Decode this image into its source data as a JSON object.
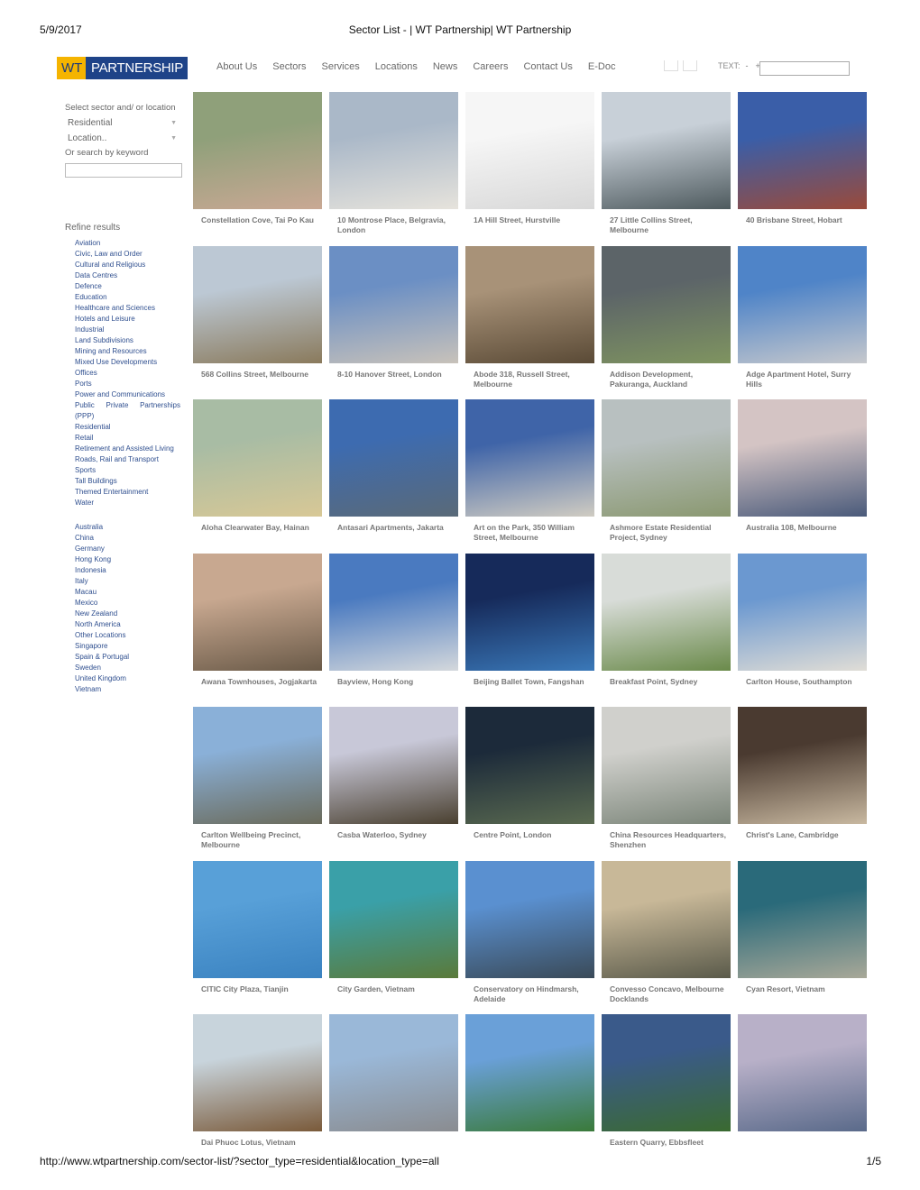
{
  "print": {
    "date": "5/9/2017",
    "title": "Sector List - | WT Partnership| WT Partnership",
    "url": "http://www.wtpartnership.com/sector-list/?sector_type=residential&location_type=all",
    "page": "1/5"
  },
  "logo": {
    "wt": "WT",
    "partnership": "PARTNERSHIP",
    "wt_bg": "#f5b400",
    "partnership_bg": "#1e4388"
  },
  "nav": [
    "About Us",
    "Sectors",
    "Services",
    "Locations",
    "News",
    "Careers",
    "Contact Us",
    "E-Doc"
  ],
  "tools": {
    "text_label": "TEXT:",
    "decrease": "-",
    "increase": "+",
    "search_placeholder": ""
  },
  "sidebar": {
    "select_label": "Select sector and/ or location",
    "sector_value": "Residential",
    "location_value": "Location..",
    "keyword_label": "Or search by keyword",
    "keyword_value": "",
    "refine_label": "Refine results",
    "sectors": [
      "Aviation",
      "Civic, Law and Order",
      "Cultural and Religious",
      "Data Centres",
      "Defence",
      "Education",
      "Healthcare and Sciences",
      "Hotels and Leisure",
      "Industrial",
      "Land Subdivisions",
      "Mining and Resources",
      "Mixed Use Developments",
      "Offices",
      "Ports",
      "Power and Communications",
      "Public Private Partnerships (PPP)",
      "Residential",
      "Retail",
      "Retirement and Assisted Living",
      "Roads, Rail and Transport",
      "Sports",
      "Tall Buildings",
      "Themed Entertainment",
      "Water"
    ],
    "locations": [
      "Australia",
      "China",
      "Germany",
      "Hong Kong",
      "Indonesia",
      "Italy",
      "Macau",
      "Mexico",
      "New Zealand",
      "North America",
      "Other Locations",
      "Singapore",
      "Spain & Portugal",
      "Sweden",
      "United Kingdom",
      "Vietnam"
    ]
  },
  "projects": [
    {
      "title": "Constellation Cove, Tai Po Kau",
      "c1": "#8fa07a",
      "c2": "#c9a894"
    },
    {
      "title": "10 Montrose Place, Belgravia, London",
      "c1": "#aab8c8",
      "c2": "#e6e3dc"
    },
    {
      "title": "1A Hill Street, Hurstville",
      "c1": "#f6f6f6",
      "c2": "#d8d8d8"
    },
    {
      "title": "27 Little Collins Street, Melbourne",
      "c1": "#c8d0d8",
      "c2": "#4e5a5e"
    },
    {
      "title": "40 Brisbane Street, Hobart",
      "c1": "#3a5ea8",
      "c2": "#9a4a3a"
    },
    {
      "title": "568 Collins Street, Melbourne",
      "c1": "#bcc8d4",
      "c2": "#8a7a5c"
    },
    {
      "title": "8-10 Hanover Street, London",
      "c1": "#6b8fc4",
      "c2": "#c8c2ba"
    },
    {
      "title": "Abode 318, Russell Street, Melbourne",
      "c1": "#a89278",
      "c2": "#5a4a36"
    },
    {
      "title": "Addison Development, Pakuranga, Auckland",
      "c1": "#5c6468",
      "c2": "#7f9460"
    },
    {
      "title": "Adge Apartment Hotel, Surry Hills",
      "c1": "#4f84c8",
      "c2": "#c6c8cc"
    },
    {
      "title": "Aloha Clearwater Bay, Hainan",
      "c1": "#a8bca4",
      "c2": "#d8c896"
    },
    {
      "title": "Antasari Apartments, Jakarta",
      "c1": "#3d6bb0",
      "c2": "#5a6a78"
    },
    {
      "title": "Art on the Park, 350 William Street, Melbourne",
      "c1": "#3f64a8",
      "c2": "#d0ccc2"
    },
    {
      "title": "Ashmore Estate Residential Project, Sydney",
      "c1": "#b8c0c0",
      "c2": "#8a9870"
    },
    {
      "title": "Australia 108, Melbourne",
      "c1": "#d4c4c4",
      "c2": "#4a5a7a"
    },
    {
      "title": "Awana Townhouses, Jogjakarta",
      "c1": "#c8a890",
      "c2": "#6a5a48"
    },
    {
      "title": "Bayview, Hong Kong",
      "c1": "#4a7ac0",
      "c2": "#d4d8dc"
    },
    {
      "title": "Beijing Ballet Town, Fangshan",
      "c1": "#162a5a",
      "c2": "#3a78b8"
    },
    {
      "title": "Breakfast Point, Sydney",
      "c1": "#d8dcd8",
      "c2": "#6a8a4a"
    },
    {
      "title": "Carlton House, Southampton",
      "c1": "#6b98d0",
      "c2": "#e0ddd6"
    },
    {
      "title": "Carlton Wellbeing Precinct, Melbourne",
      "c1": "#8ab0d8",
      "c2": "#6a6a5a"
    },
    {
      "title": "Casba Waterloo, Sydney",
      "c1": "#c8c8d8",
      "c2": "#4a4030"
    },
    {
      "title": "Centre Point, London",
      "c1": "#1c2a3a",
      "c2": "#5a6a50"
    },
    {
      "title": "China Resources Headquarters, Shenzhen",
      "c1": "#d0d0cc",
      "c2": "#7a8478"
    },
    {
      "title": "Christ's Lane, Cambridge",
      "c1": "#4a3a30",
      "c2": "#c8b8a0"
    },
    {
      "title": "CITIC City Plaza, Tianjin",
      "c1": "#58a0d8",
      "c2": "#3a82c0"
    },
    {
      "title": "City Garden, Vietnam",
      "c1": "#3aa0a8",
      "c2": "#5a7a3a"
    },
    {
      "title": "Conservatory on Hindmarsh, Adelaide",
      "c1": "#5a90d0",
      "c2": "#3a4a58"
    },
    {
      "title": "Convesso Concavo, Melbourne Docklands",
      "c1": "#c8b898",
      "c2": "#5a5a4a"
    },
    {
      "title": "Cyan Resort, Vietnam",
      "c1": "#2a6a7a",
      "c2": "#a8a898"
    },
    {
      "title": "Dai Phuoc Lotus, Vietnam",
      "c1": "#c8d4dc",
      "c2": "#7a5a3a"
    },
    {
      "title": "",
      "c1": "#9ab8d8",
      "c2": "#8a8c90"
    },
    {
      "title": "",
      "c1": "#6aa0d8",
      "c2": "#3a7a3a"
    },
    {
      "title": "Eastern Quarry, Ebbsfleet",
      "c1": "#3a5a8a",
      "c2": "#3a6a30"
    },
    {
      "title": "",
      "c1": "#b8b0c8",
      "c2": "#5a6a8a"
    }
  ]
}
